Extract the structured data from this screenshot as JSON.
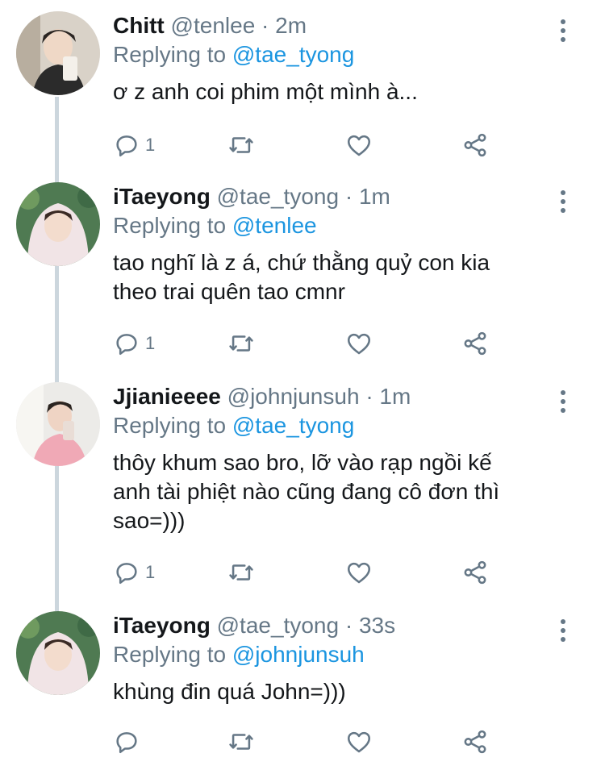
{
  "colors": {
    "accent": "#1b95e0",
    "muted": "#657786",
    "text": "#14171a",
    "thread_line": "#ccd6dd"
  },
  "tweets": [
    {
      "name": "Chitt",
      "handle": "@tenlee",
      "separator": "·",
      "time": "2m",
      "replying_label": "Replying to",
      "replying_to": "@tae_tyong",
      "lines": [
        "ơ z anh coi phim một mình à..."
      ],
      "reply_count": "1"
    },
    {
      "name": "iTaeyong",
      "handle": "@tae_tyong",
      "separator": "·",
      "time": "1m",
      "replying_label": "Replying to",
      "replying_to": "@tenlee",
      "lines": [
        "tao nghĩ là z á, chứ thằng quỷ con kia",
        "theo trai quên tao cmnr"
      ],
      "reply_count": "1"
    },
    {
      "name": "Jjianieeee",
      "handle": "@johnjunsuh",
      "separator": "·",
      "time": "1m",
      "replying_label": "Replying to",
      "replying_to": "@tae_tyong",
      "lines": [
        "thôy khum sao bro, lỡ vào rạp ngồi kế",
        "anh tài phiệt nào cũng đang cô đơn thì",
        "sao=)))"
      ],
      "reply_count": "1"
    },
    {
      "name": "iTaeyong",
      "handle": "@tae_tyong",
      "separator": "·",
      "time": "33s",
      "replying_label": "Replying to",
      "replying_to": "@johnjunsuh",
      "lines": [
        "khùng đin quá John=)))"
      ],
      "reply_count": ""
    }
  ],
  "icons": {
    "reply": "reply-icon",
    "retweet": "retweet-icon",
    "like": "heart-icon",
    "share": "share-icon",
    "more": "more-vertical-icon"
  }
}
